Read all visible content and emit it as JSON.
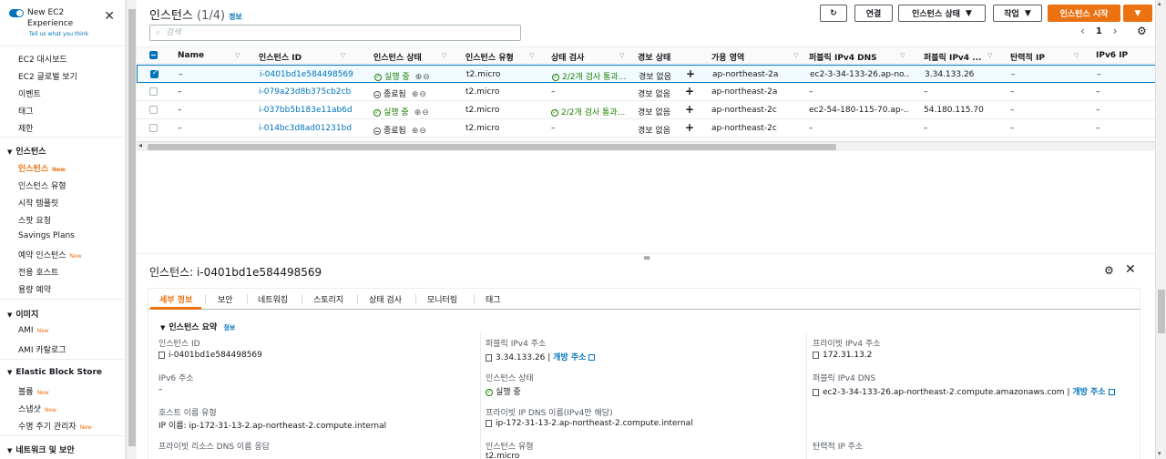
{
  "sidebar": {
    "toggle_label": "New EC2 Experience",
    "tell_us": "Tell us what you think",
    "items_top": [
      "EC2 대시보드",
      "EC2 글로벌 보기",
      "이벤트",
      "태그",
      "제한"
    ],
    "sections": [
      {
        "title": "인스턴스",
        "items": [
          {
            "label": "인스턴스",
            "new": "New",
            "active": true
          },
          {
            "label": "인스턴스 유형"
          },
          {
            "label": "시작 템플릿"
          },
          {
            "label": "스팟 요청"
          },
          {
            "label": "Savings Plans"
          },
          {
            "label": "예약 인스턴스",
            "new": "New"
          },
          {
            "label": "전용 호스트"
          },
          {
            "label": "용량 예약"
          }
        ]
      },
      {
        "title": "이미지",
        "items": [
          {
            "label": "AMI",
            "new": "New"
          },
          {
            "label": "AMI 카탈로그"
          }
        ]
      },
      {
        "title": "Elastic Block Store",
        "items": [
          {
            "label": "볼륨",
            "new": "New"
          },
          {
            "label": "스냅샷",
            "new": "New"
          },
          {
            "label": "수명 주기 관리자",
            "new": "New"
          }
        ]
      },
      {
        "title": "네트워크 및 보안",
        "items": []
      }
    ]
  },
  "header": {
    "title": "인스턴스",
    "count": "(1/4)",
    "info": "정보",
    "connect_label": "연결",
    "state_label": "인스턴스 상태",
    "actions_label": "작업",
    "launch_label": "인스턴스 시작",
    "search_placeholder": "검색",
    "page": "1"
  },
  "table": {
    "columns": [
      "Name",
      "인스턴스 ID",
      "인스턴스 상태",
      "인스턴스 유형",
      "상태 검사",
      "경보 상태",
      "가용 영역",
      "퍼블릭 IPv4 DNS",
      "퍼블릭 IPv4 ...",
      "탄력적 IP",
      "IPv6 IP"
    ],
    "rows": [
      {
        "name": "–",
        "id": "i-0401bd1e584498569",
        "state": "실행 중",
        "running": true,
        "type": "t2.micro",
        "check": "2/2개 검사 통과...",
        "alarm": "경보 없음",
        "az": "ap-northeast-2a",
        "dns": "ec2-3-34-133-26.ap-no...",
        "ip": "3.34.133.26",
        "eip": "–",
        "ipv6": "–",
        "selected": true
      },
      {
        "name": "–",
        "id": "i-079a23d8b375cb2cb",
        "state": "종료됨",
        "running": false,
        "type": "t2.micro",
        "check": "–",
        "alarm": "경보 없음",
        "az": "ap-northeast-2a",
        "dns": "–",
        "ip": "–",
        "eip": "–",
        "ipv6": "–",
        "selected": false
      },
      {
        "name": "–",
        "id": "i-037bb5b183e11ab6d",
        "state": "실행 중",
        "running": true,
        "type": "t2.micro",
        "check": "2/2개 검사 통과...",
        "alarm": "경보 없음",
        "az": "ap-northeast-2c",
        "dns": "ec2-54-180-115-70.ap-...",
        "ip": "54.180.115.70",
        "eip": "–",
        "ipv6": "–",
        "selected": false
      },
      {
        "name": "–",
        "id": "i-014bc3d8ad01231bd",
        "state": "종료됨",
        "running": false,
        "type": "t2.micro",
        "check": "–",
        "alarm": "경보 없음",
        "az": "ap-northeast-2c",
        "dns": "–",
        "ip": "–",
        "eip": "–",
        "ipv6": "–",
        "selected": false
      }
    ]
  },
  "detail": {
    "title": "인스턴스: i-0401bd1e584498569",
    "tabs": [
      "세부 정보",
      "보안",
      "네트워킹",
      "스토리지",
      "상태 검사",
      "모니터링",
      "태그"
    ],
    "summary_title": "인스턴스 요약",
    "summary_info": "정보",
    "fields": {
      "instance_id_label": "인스턴스 ID",
      "instance_id": "i-0401bd1e584498569",
      "public_ipv4_label": "퍼블릭 IPv4 주소",
      "public_ipv4": "3.34.133.26",
      "open_address": "개방 주소",
      "private_ipv4_label": "프라이빗 IPv4 주소",
      "private_ipv4": "172.31.13.2",
      "ipv6_label": "IPv6 주소",
      "ipv6": "–",
      "state_label": "인스턴스 상태",
      "state": "실행 중",
      "public_dns_label": "퍼블릭 IPv4 DNS",
      "public_dns": "ec2-3-34-133-26.ap-northeast-2.compute.amazonaws.com",
      "hostname_type_label": "호스트 이름 유형",
      "hostname_type": "IP 이름: ip-172-31-13-2.ap-northeast-2.compute.internal",
      "private_dns_label": "프라이빗 IP DNS 이름(IPv4만 해당)",
      "private_dns": "ip-172-31-13-2.ap-northeast-2.compute.internal",
      "resource_dns_label": "프라이빗 리소스 DNS 이름 응답",
      "type_label": "인스턴스 유형",
      "type": "t2.micro",
      "eip_label": "탄력적 IP 주소"
    }
  }
}
